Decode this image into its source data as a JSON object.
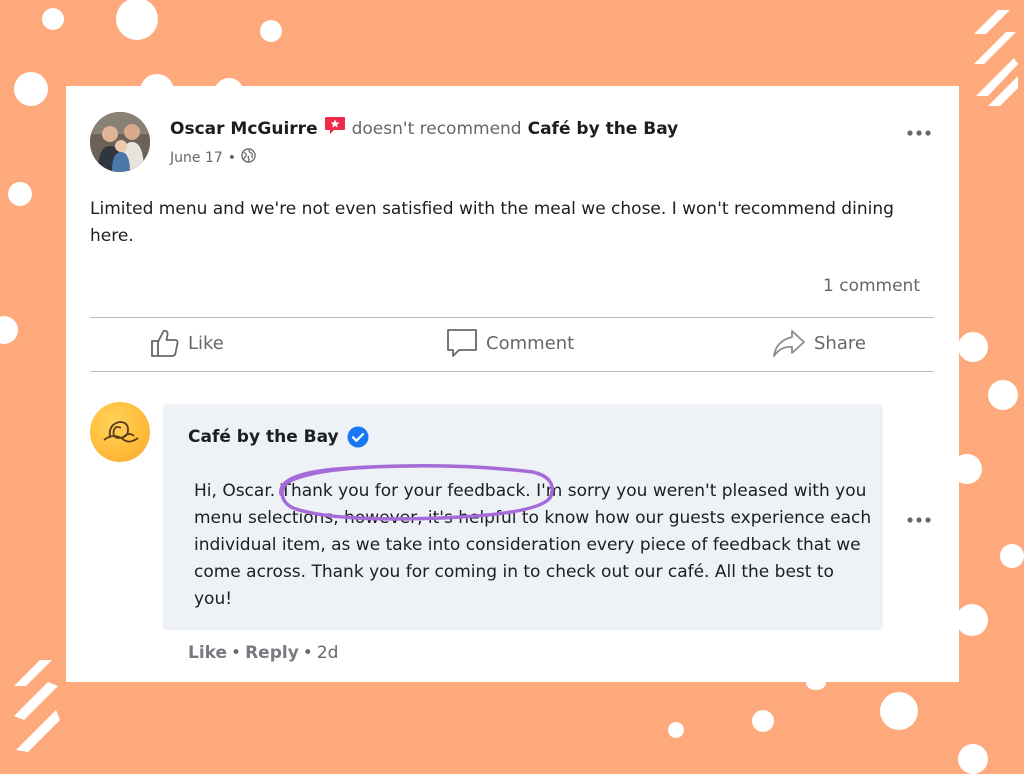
{
  "post": {
    "author": "Oscar McGuirre",
    "action_text": "doesn't recommend",
    "business": "Café by the Bay",
    "date": "June 17",
    "separator": "•",
    "privacy_icon": "globe-icon",
    "text": "Limited menu and we're not even satisfied with the meal we chose. I won't recommend dining here.",
    "comment_count": "1 comment"
  },
  "actions": {
    "like": "Like",
    "comment": "Comment",
    "share": "Share"
  },
  "comment": {
    "author": "Café by the Bay",
    "verified_icon": "verified-badge-icon",
    "text_before": "Hi, Oscar. ",
    "text_highlight": "Thank you for your feedback.",
    "text_after": " I'm sorry you weren't pleased with you menu selections, however, it's helpful to know how our guests experience each individual item, as we take into consideration every piece of feedback that we come across. Thank you for coming in to check out our café. All the best to you!",
    "like": "Like",
    "reply": "Reply",
    "sep": "•",
    "age": "2d"
  },
  "colors": {
    "background": "#fda97b",
    "highlight_circle": "#a56bd8",
    "verified": "#1877f2",
    "not_recommend": "#f02849"
  }
}
